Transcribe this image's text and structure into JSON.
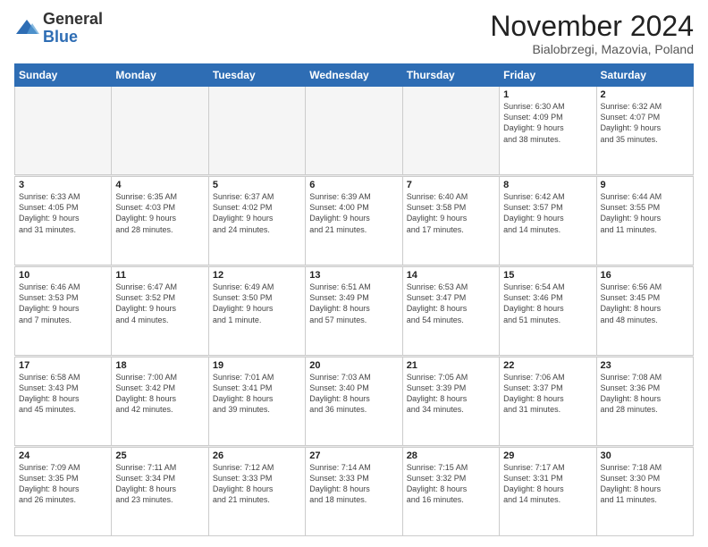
{
  "logo": {
    "general": "General",
    "blue": "Blue"
  },
  "header": {
    "month": "November 2024",
    "location": "Bialobrzegi, Mazovia, Poland"
  },
  "weekdays": [
    "Sunday",
    "Monday",
    "Tuesday",
    "Wednesday",
    "Thursday",
    "Friday",
    "Saturday"
  ],
  "weeks": [
    [
      {
        "day": "",
        "info": ""
      },
      {
        "day": "",
        "info": ""
      },
      {
        "day": "",
        "info": ""
      },
      {
        "day": "",
        "info": ""
      },
      {
        "day": "",
        "info": ""
      },
      {
        "day": "1",
        "info": "Sunrise: 6:30 AM\nSunset: 4:09 PM\nDaylight: 9 hours\nand 38 minutes."
      },
      {
        "day": "2",
        "info": "Sunrise: 6:32 AM\nSunset: 4:07 PM\nDaylight: 9 hours\nand 35 minutes."
      }
    ],
    [
      {
        "day": "3",
        "info": "Sunrise: 6:33 AM\nSunset: 4:05 PM\nDaylight: 9 hours\nand 31 minutes."
      },
      {
        "day": "4",
        "info": "Sunrise: 6:35 AM\nSunset: 4:03 PM\nDaylight: 9 hours\nand 28 minutes."
      },
      {
        "day": "5",
        "info": "Sunrise: 6:37 AM\nSunset: 4:02 PM\nDaylight: 9 hours\nand 24 minutes."
      },
      {
        "day": "6",
        "info": "Sunrise: 6:39 AM\nSunset: 4:00 PM\nDaylight: 9 hours\nand 21 minutes."
      },
      {
        "day": "7",
        "info": "Sunrise: 6:40 AM\nSunset: 3:58 PM\nDaylight: 9 hours\nand 17 minutes."
      },
      {
        "day": "8",
        "info": "Sunrise: 6:42 AM\nSunset: 3:57 PM\nDaylight: 9 hours\nand 14 minutes."
      },
      {
        "day": "9",
        "info": "Sunrise: 6:44 AM\nSunset: 3:55 PM\nDaylight: 9 hours\nand 11 minutes."
      }
    ],
    [
      {
        "day": "10",
        "info": "Sunrise: 6:46 AM\nSunset: 3:53 PM\nDaylight: 9 hours\nand 7 minutes."
      },
      {
        "day": "11",
        "info": "Sunrise: 6:47 AM\nSunset: 3:52 PM\nDaylight: 9 hours\nand 4 minutes."
      },
      {
        "day": "12",
        "info": "Sunrise: 6:49 AM\nSunset: 3:50 PM\nDaylight: 9 hours\nand 1 minute."
      },
      {
        "day": "13",
        "info": "Sunrise: 6:51 AM\nSunset: 3:49 PM\nDaylight: 8 hours\nand 57 minutes."
      },
      {
        "day": "14",
        "info": "Sunrise: 6:53 AM\nSunset: 3:47 PM\nDaylight: 8 hours\nand 54 minutes."
      },
      {
        "day": "15",
        "info": "Sunrise: 6:54 AM\nSunset: 3:46 PM\nDaylight: 8 hours\nand 51 minutes."
      },
      {
        "day": "16",
        "info": "Sunrise: 6:56 AM\nSunset: 3:45 PM\nDaylight: 8 hours\nand 48 minutes."
      }
    ],
    [
      {
        "day": "17",
        "info": "Sunrise: 6:58 AM\nSunset: 3:43 PM\nDaylight: 8 hours\nand 45 minutes."
      },
      {
        "day": "18",
        "info": "Sunrise: 7:00 AM\nSunset: 3:42 PM\nDaylight: 8 hours\nand 42 minutes."
      },
      {
        "day": "19",
        "info": "Sunrise: 7:01 AM\nSunset: 3:41 PM\nDaylight: 8 hours\nand 39 minutes."
      },
      {
        "day": "20",
        "info": "Sunrise: 7:03 AM\nSunset: 3:40 PM\nDaylight: 8 hours\nand 36 minutes."
      },
      {
        "day": "21",
        "info": "Sunrise: 7:05 AM\nSunset: 3:39 PM\nDaylight: 8 hours\nand 34 minutes."
      },
      {
        "day": "22",
        "info": "Sunrise: 7:06 AM\nSunset: 3:37 PM\nDaylight: 8 hours\nand 31 minutes."
      },
      {
        "day": "23",
        "info": "Sunrise: 7:08 AM\nSunset: 3:36 PM\nDaylight: 8 hours\nand 28 minutes."
      }
    ],
    [
      {
        "day": "24",
        "info": "Sunrise: 7:09 AM\nSunset: 3:35 PM\nDaylight: 8 hours\nand 26 minutes."
      },
      {
        "day": "25",
        "info": "Sunrise: 7:11 AM\nSunset: 3:34 PM\nDaylight: 8 hours\nand 23 minutes."
      },
      {
        "day": "26",
        "info": "Sunrise: 7:12 AM\nSunset: 3:33 PM\nDaylight: 8 hours\nand 21 minutes."
      },
      {
        "day": "27",
        "info": "Sunrise: 7:14 AM\nSunset: 3:33 PM\nDaylight: 8 hours\nand 18 minutes."
      },
      {
        "day": "28",
        "info": "Sunrise: 7:15 AM\nSunset: 3:32 PM\nDaylight: 8 hours\nand 16 minutes."
      },
      {
        "day": "29",
        "info": "Sunrise: 7:17 AM\nSunset: 3:31 PM\nDaylight: 8 hours\nand 14 minutes."
      },
      {
        "day": "30",
        "info": "Sunrise: 7:18 AM\nSunset: 3:30 PM\nDaylight: 8 hours\nand 11 minutes."
      }
    ]
  ]
}
